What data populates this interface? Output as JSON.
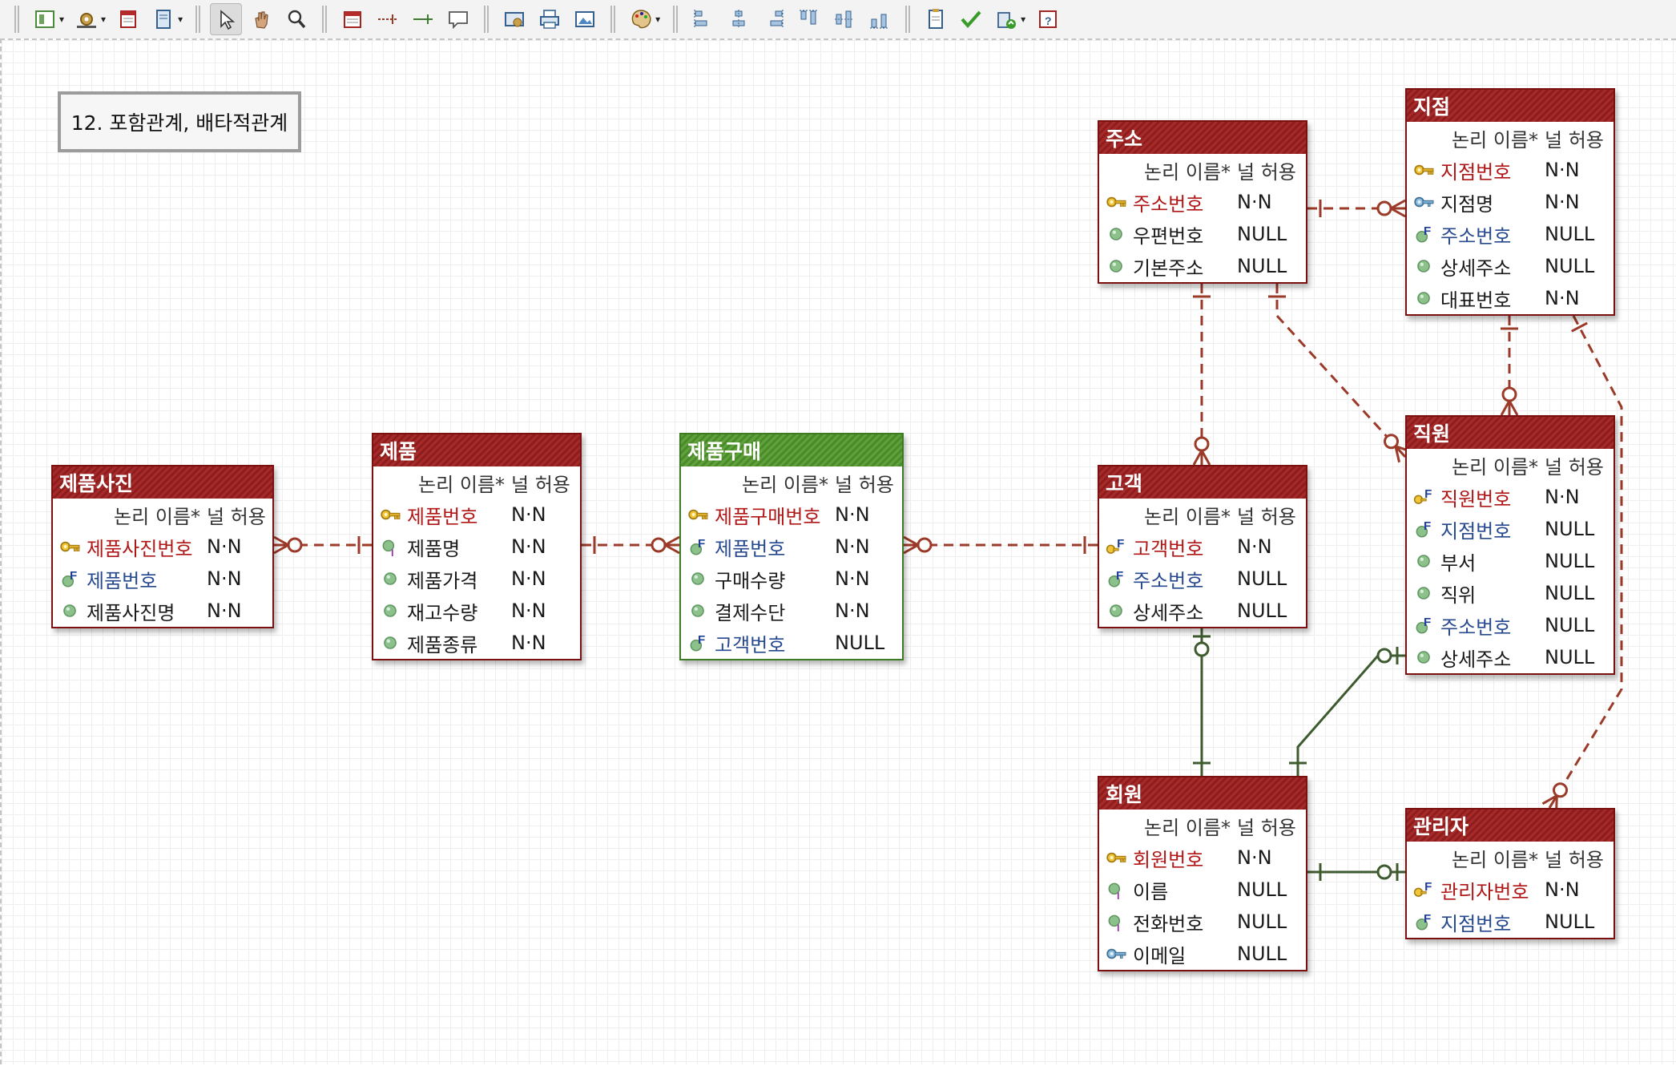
{
  "toolbar": {
    "items": [
      {
        "icon": "layout-icon"
      },
      {
        "icon": "gear-icon"
      },
      {
        "icon": "calendar-icon"
      },
      {
        "icon": "document-icon"
      },
      {
        "icon": "pointer-icon",
        "active": true
      },
      {
        "icon": "hand-icon"
      },
      {
        "icon": "zoom-icon"
      },
      {
        "icon": "new-table-icon"
      },
      {
        "icon": "dashed-relation-icon"
      },
      {
        "icon": "solid-relation-icon"
      },
      {
        "icon": "comment-icon"
      },
      {
        "icon": "export-icon"
      },
      {
        "icon": "print-icon"
      },
      {
        "icon": "image-icon"
      },
      {
        "icon": "palette-icon"
      },
      {
        "icon": "align-left-icon"
      },
      {
        "icon": "align-center-icon"
      },
      {
        "icon": "align-right-icon"
      },
      {
        "icon": "align-top-icon"
      },
      {
        "icon": "align-middle-icon"
      },
      {
        "icon": "align-bottom-icon"
      },
      {
        "icon": "report-icon"
      },
      {
        "icon": "validate-icon"
      },
      {
        "icon": "sync-icon"
      },
      {
        "icon": "help-icon"
      }
    ]
  },
  "diagram": {
    "title": "12. 포함관계, 배타적관계",
    "colors": {
      "entity": "#8e1c1c",
      "associative": "#4b8a2b",
      "relation_dashed": "#9b3a28",
      "relation_solid": "#3d5b2e"
    },
    "column_headers": {
      "name": "논리 이름*",
      "nullable": "널 허용"
    },
    "entities": [
      {
        "id": "product_photo",
        "name": "제품사진",
        "style": "red",
        "attributes": [
          {
            "name": "제품사진번호",
            "kind": "pk",
            "nullable": "N·N"
          },
          {
            "name": "제품번호",
            "kind": "fk",
            "nullable": "N·N"
          },
          {
            "name": "제품사진명",
            "kind": "attr",
            "nullable": "N·N"
          }
        ]
      },
      {
        "id": "product",
        "name": "제품",
        "style": "red",
        "attributes": [
          {
            "name": "제품번호",
            "kind": "pk",
            "nullable": "N·N"
          },
          {
            "name": "제품명",
            "kind": "index",
            "nullable": "N·N"
          },
          {
            "name": "제품가격",
            "kind": "attr",
            "nullable": "N·N"
          },
          {
            "name": "재고수량",
            "kind": "attr",
            "nullable": "N·N"
          },
          {
            "name": "제품종류",
            "kind": "attr",
            "nullable": "N·N"
          }
        ]
      },
      {
        "id": "purchase",
        "name": "제품구매",
        "style": "green",
        "attributes": [
          {
            "name": "제품구매번호",
            "kind": "pk",
            "nullable": "N·N"
          },
          {
            "name": "제품번호",
            "kind": "fk",
            "nullable": "N·N"
          },
          {
            "name": "구매수량",
            "kind": "attr",
            "nullable": "N·N"
          },
          {
            "name": "결제수단",
            "kind": "attr",
            "nullable": "N·N"
          },
          {
            "name": "고객번호",
            "kind": "fk",
            "nullable": "NULL"
          }
        ]
      },
      {
        "id": "address",
        "name": "주소",
        "style": "red",
        "attributes": [
          {
            "name": "주소번호",
            "kind": "pk",
            "nullable": "N·N"
          },
          {
            "name": "우편번호",
            "kind": "attr",
            "nullable": "NULL"
          },
          {
            "name": "기본주소",
            "kind": "attr",
            "nullable": "NULL"
          }
        ]
      },
      {
        "id": "customer",
        "name": "고객",
        "style": "red",
        "attributes": [
          {
            "name": "고객번호",
            "kind": "pkfk",
            "nullable": "N·N"
          },
          {
            "name": "주소번호",
            "kind": "fk",
            "nullable": "NULL"
          },
          {
            "name": "상세주소",
            "kind": "attr",
            "nullable": "NULL"
          }
        ]
      },
      {
        "id": "member",
        "name": "회원",
        "style": "red",
        "attributes": [
          {
            "name": "회원번호",
            "kind": "pk",
            "nullable": "N·N"
          },
          {
            "name": "이름",
            "kind": "index",
            "nullable": "NULL"
          },
          {
            "name": "전화번호",
            "kind": "index",
            "nullable": "NULL"
          },
          {
            "name": "이메일",
            "kind": "ak",
            "nullable": "NULL"
          }
        ]
      },
      {
        "id": "branch",
        "name": "지점",
        "style": "red",
        "attributes": [
          {
            "name": "지점번호",
            "kind": "pk",
            "nullable": "N·N"
          },
          {
            "name": "지점명",
            "kind": "ak",
            "nullable": "N·N"
          },
          {
            "name": "주소번호",
            "kind": "fk",
            "nullable": "NULL"
          },
          {
            "name": "상세주소",
            "kind": "attr",
            "nullable": "NULL"
          },
          {
            "name": "대표번호",
            "kind": "attr",
            "nullable": "N·N"
          }
        ]
      },
      {
        "id": "employee",
        "name": "직원",
        "style": "red",
        "attributes": [
          {
            "name": "직원번호",
            "kind": "pkfk",
            "nullable": "N·N"
          },
          {
            "name": "지점번호",
            "kind": "fk",
            "nullable": "NULL"
          },
          {
            "name": "부서",
            "kind": "attr",
            "nullable": "NULL"
          },
          {
            "name": "직위",
            "kind": "attr",
            "nullable": "NULL"
          },
          {
            "name": "주소번호",
            "kind": "fk",
            "nullable": "NULL"
          },
          {
            "name": "상세주소",
            "kind": "attr",
            "nullable": "NULL"
          }
        ]
      },
      {
        "id": "admin",
        "name": "관리자",
        "style": "red",
        "attributes": [
          {
            "name": "관리자번호",
            "kind": "pkfk",
            "nullable": "N·N"
          },
          {
            "name": "지점번호",
            "kind": "fk",
            "nullable": "NULL"
          }
        ]
      }
    ],
    "relationships": [
      {
        "from": "product",
        "to": "product_photo",
        "style": "dashed",
        "from_end": "one",
        "to_end": "zero-or-many"
      },
      {
        "from": "product",
        "to": "purchase",
        "style": "dashed",
        "from_end": "one",
        "to_end": "zero-or-many"
      },
      {
        "from": "customer",
        "to": "purchase",
        "style": "dashed",
        "from_end": "one",
        "to_end": "zero-or-many"
      },
      {
        "from": "address",
        "to": "customer",
        "style": "dashed",
        "from_end": "one",
        "to_end": "zero-or-many"
      },
      {
        "from": "address",
        "to": "branch",
        "style": "dashed",
        "from_end": "one",
        "to_end": "zero-or-many"
      },
      {
        "from": "address",
        "to": "employee",
        "style": "dashed",
        "from_end": "one",
        "to_end": "zero-or-many"
      },
      {
        "from": "branch",
        "to": "employee",
        "style": "dashed",
        "from_end": "one",
        "to_end": "zero-or-many"
      },
      {
        "from": "branch",
        "to": "admin",
        "style": "dashed",
        "from_end": "one",
        "to_end": "zero-or-many"
      },
      {
        "from": "member",
        "to": "customer",
        "style": "solid",
        "from_end": "one",
        "to_end": "zero-or-one"
      },
      {
        "from": "member",
        "to": "employee",
        "style": "solid",
        "from_end": "one",
        "to_end": "zero-or-one"
      },
      {
        "from": "member",
        "to": "admin",
        "style": "solid",
        "from_end": "one",
        "to_end": "zero-or-one"
      }
    ]
  }
}
